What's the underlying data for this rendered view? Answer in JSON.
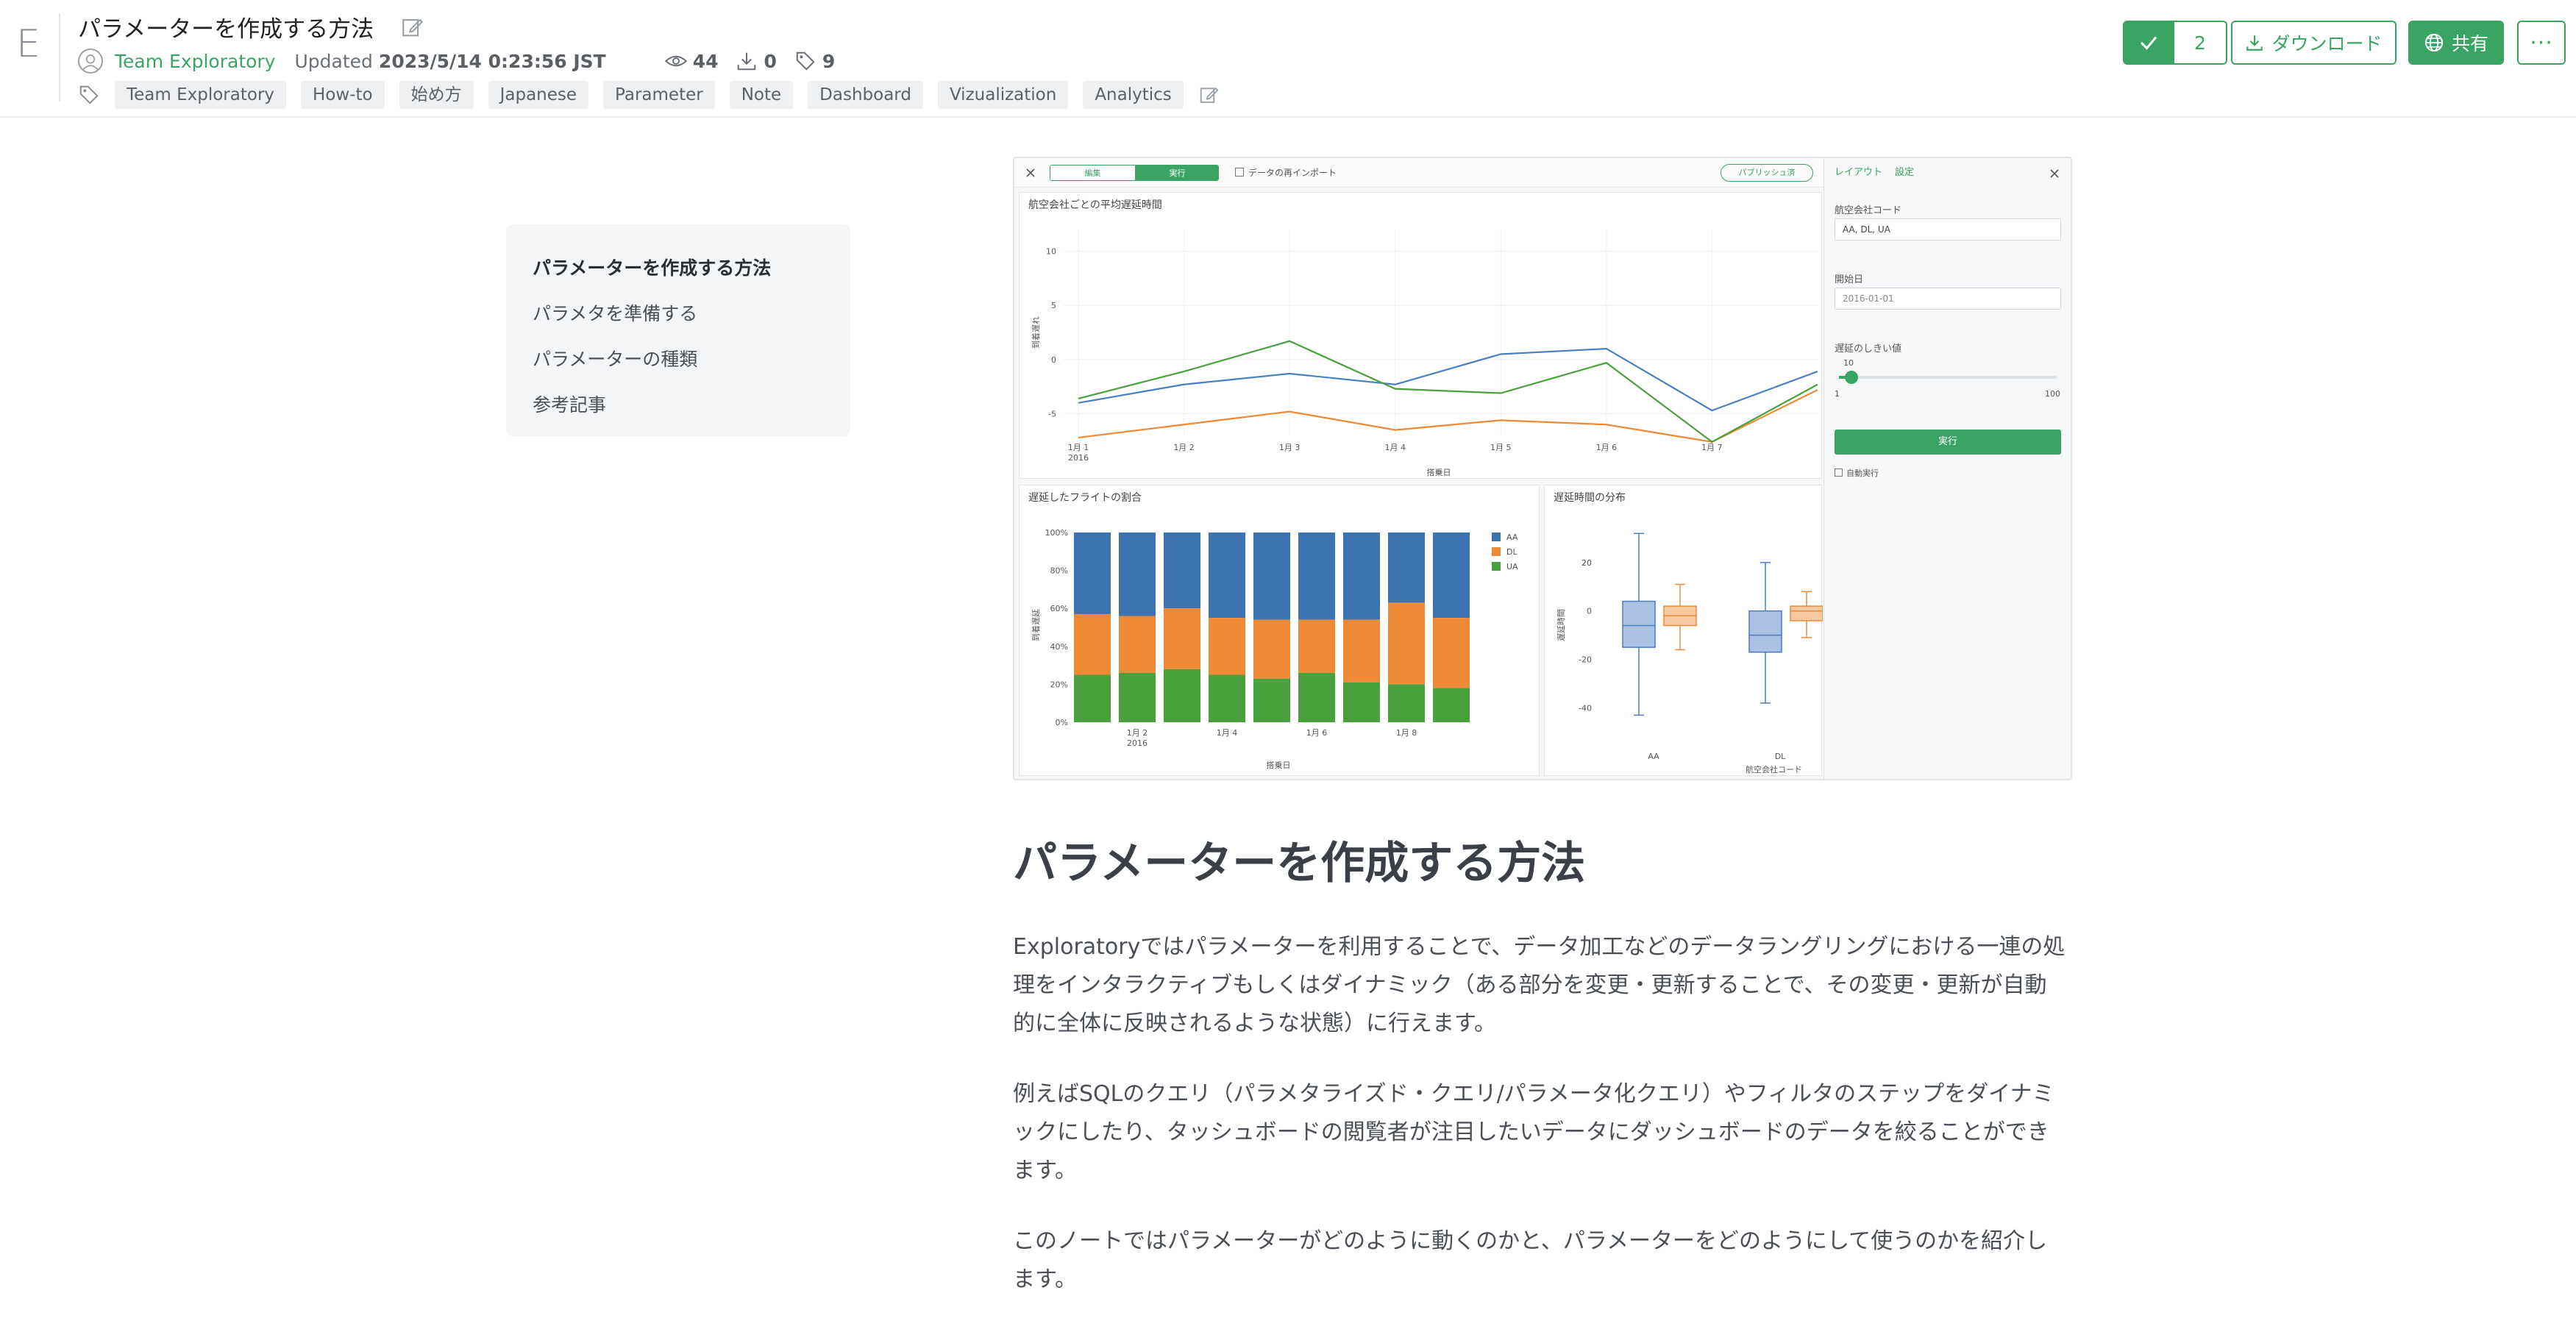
{
  "header": {
    "logo": "E",
    "title": "パラメーターを作成する方法",
    "team": "Team Exploratory",
    "updated_label": "Updated",
    "updated_value": "2023/5/14 0:23:56 JST",
    "views": "44",
    "downloads": "0",
    "tag_count": "9",
    "tags": [
      "Team Exploratory",
      "How-to",
      "始め方",
      "Japanese",
      "Parameter",
      "Note",
      "Dashboard",
      "Vizualization",
      "Analytics"
    ]
  },
  "actions": {
    "like_count": "2",
    "download_label": "ダウンロード",
    "share_label": "共有",
    "more_label": "···"
  },
  "toc": {
    "items": [
      "パラメーターを作成する方法",
      "パラメタを準備する",
      "パラメーターの種類",
      "参考記事"
    ]
  },
  "screenshot": {
    "toolbar": {
      "edit": "編集",
      "run": "実行",
      "reimport": "データの再インポート",
      "published": "パブリッシュ済"
    },
    "sidebar": {
      "tab_layout": "レイアウト",
      "tab_settings": "設定",
      "airline_label": "航空会社コード",
      "airline_value": "AA, DL, UA",
      "start_label": "開始日",
      "start_value": "2016-01-01",
      "threshold_label": "遅延のしきい値",
      "threshold_value": "10",
      "threshold_min": "1",
      "threshold_max": "100",
      "run_label": "実行",
      "auto_run_label": "自動実行"
    }
  },
  "chart_data": [
    {
      "type": "line",
      "title": "航空会社ごとの平均遅延時間",
      "xlabel": "搭乗日",
      "ylabel": "到着遅れ",
      "x": [
        "1月 1\n2016",
        "1月 2",
        "1月 3",
        "1月 4",
        "1月 5",
        "1月 6",
        "1月 7"
      ],
      "ylim": [
        -7,
        12
      ],
      "yticks": [
        10,
        5,
        0,
        -5
      ],
      "series": [
        {
          "color": "#4a7fc1",
          "values": [
            -4,
            -2.3,
            -1.3,
            -2.3,
            0.5,
            1,
            -4.7,
            -1.1
          ]
        },
        {
          "color": "#ee8a35",
          "values": [
            -7.2,
            -6,
            -4.8,
            -6.5,
            -5.6,
            -6,
            -7.6,
            -2.8
          ]
        },
        {
          "color": "#48a13d",
          "values": [
            -3.6,
            -1.1,
            1.7,
            -2.7,
            -3.1,
            -0.3,
            -7.6,
            -2.3
          ]
        }
      ]
    },
    {
      "type": "bar",
      "title": "遅延したフライトの割合",
      "xlabel": "搭乗日",
      "ylabel": "到着遅延",
      "categories": [
        "",
        "1月 2\n2016",
        "",
        "1月 4",
        "",
        "1月 6",
        "",
        "1月 8",
        ""
      ],
      "yticks": [
        "100%",
        "80%",
        "60%",
        "40%",
        "20%",
        "0%"
      ],
      "series": [
        {
          "name": "AA",
          "color": "#3e73b1",
          "values": [
            43,
            44,
            40,
            45,
            46,
            46,
            46,
            37,
            45
          ]
        },
        {
          "name": "DL",
          "color": "#ee8a35",
          "values": [
            32,
            30,
            32,
            30,
            31,
            28,
            33,
            43,
            37
          ]
        },
        {
          "name": "UA",
          "color": "#48a13d",
          "values": [
            25,
            26,
            28,
            25,
            23,
            26,
            21,
            20,
            18
          ]
        }
      ]
    },
    {
      "type": "box",
      "title": "遅延時間の分布",
      "xlabel": "航空会社コード",
      "ylabel": "遅延時間",
      "categories": [
        "AA",
        "DL"
      ],
      "yticks": [
        20,
        0,
        -20,
        -40
      ],
      "series": [
        {
          "color": "#4a7fc1",
          "boxes": [
            {
              "cat": "AA",
              "min": -43,
              "q1": -15,
              "med": -6,
              "q3": 4,
              "max": 32
            },
            {
              "cat": "DL",
              "min": -38,
              "q1": -17,
              "med": -10,
              "q3": 0,
              "max": 20
            }
          ]
        },
        {
          "color": "#ee8a35",
          "boxes": [
            {
              "cat": "AA",
              "min": -16,
              "q1": -6,
              "med": -2,
              "q3": 2,
              "max": 11
            },
            {
              "cat": "DL",
              "min": -11,
              "q1": -4,
              "med": 0,
              "q3": 2,
              "max": 8
            }
          ]
        }
      ]
    }
  ],
  "article": {
    "heading": "パラメーターを作成する方法",
    "p1_line1": "Exploratoryではパラメーターを利用することで、データ加工などのデータラングリングにおける一連の処",
    "p1_line2": "理をインタラクティブもしくはダイナミック（ある部分を変更・更新することで、その変更・更新が自動",
    "p1_line3": "的に全体に反映されるような状態）に行えます。",
    "p2_line1": "例えばSQLのクエリ（パラメタライズド・クエリ/パラメータ化クエリ）やフィルタのステップをダイナミ",
    "p2_line2": "ックにしたり、タッシュボードの閲覧者が注目したいデータにダッシュボードのデータを絞ることができ",
    "p2_line3": "ます。",
    "p3_line1": "このノートではパラメーターがどのように動くのかと、パラメーターをどのようにして使うのかを紹介し",
    "p3_line2": "ます。"
  }
}
